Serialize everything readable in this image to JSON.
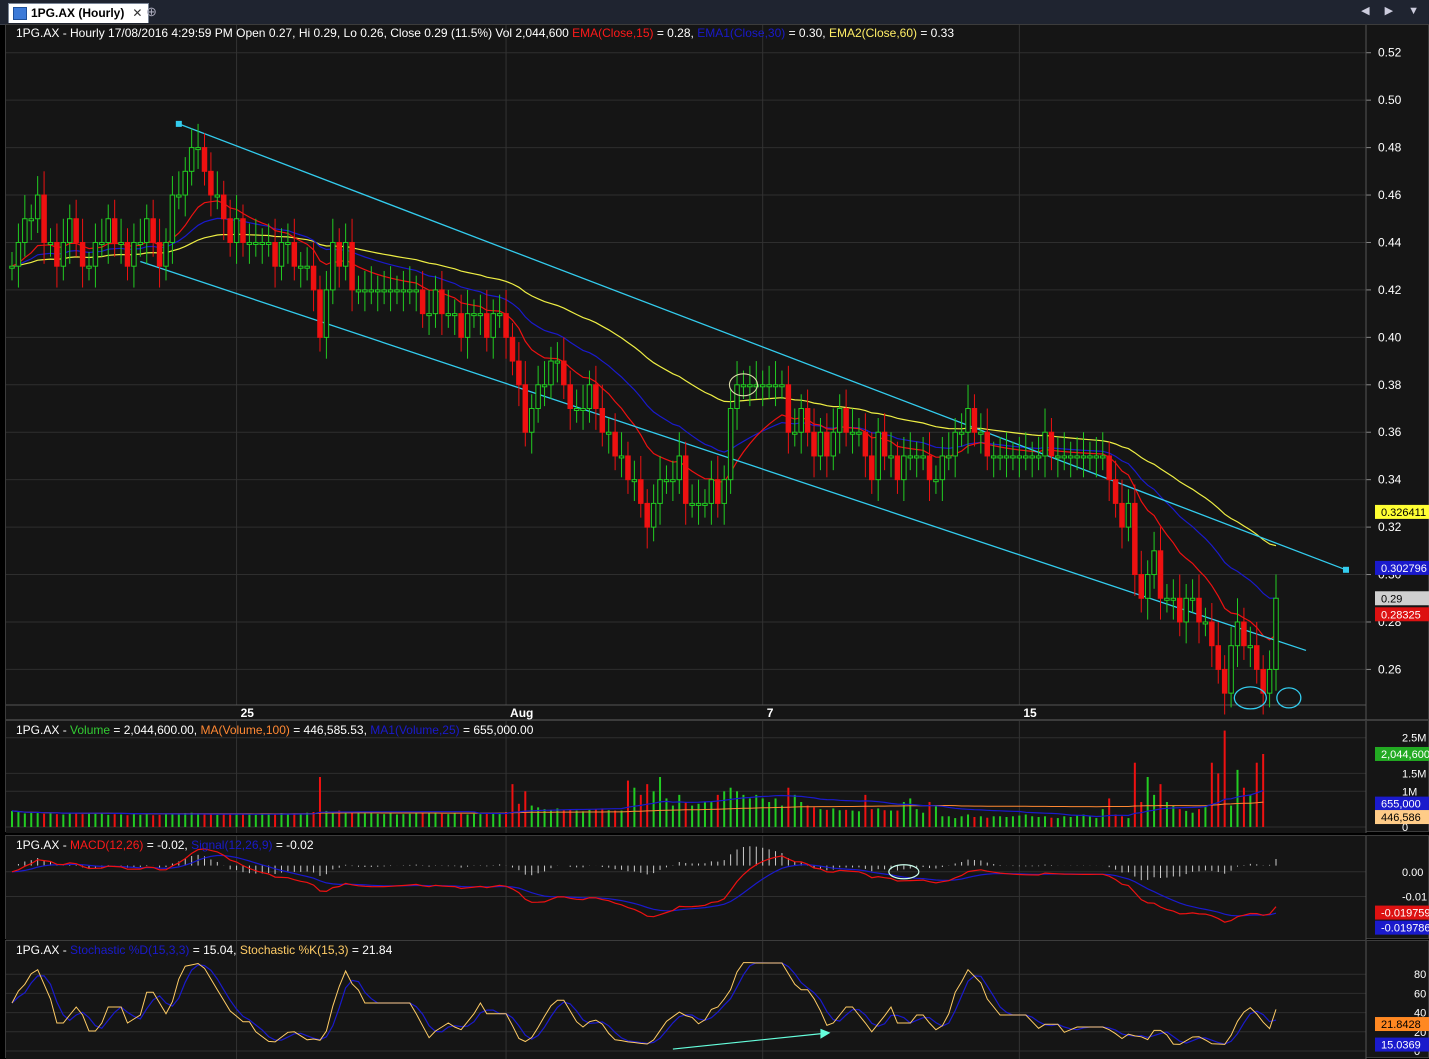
{
  "tab": {
    "title": "1PG.AX (Hourly)",
    "close_glyph": "✕",
    "add_glyph": "⊕",
    "nav": "◀ ▶ ▼"
  },
  "price_header": {
    "prefix": "1PG.AX - Hourly 17/08/2016 4:29:59 PM Open 0.27, Hi 0.29, Lo 0.26, Close 0.29 (11.5%) Vol 2,044,600",
    "ema": "EMA(Close,15)",
    "ema_val": " = 0.28,",
    "ema1": "EMA1(Close,30)",
    "ema1_val": " = 0.30,",
    "ema2": "EMA2(Close,60)",
    "ema2_val": " = 0.33"
  },
  "volume_header": {
    "prefix": "1PG.AX - ",
    "vol": "Volume",
    "vol_val": " = 2,044,600.00,",
    "ma": "MA(Volume,100)",
    "ma_val": " = 446,585.53,",
    "ma1": "MA1(Volume,25)",
    "ma1_val": " = 655,000.00"
  },
  "macd_header": {
    "prefix": "1PG.AX - ",
    "macd": "MACD(12,26)",
    "macd_val": " = -0.02,",
    "sig": "Signal(12,26,9)",
    "sig_val": " = -0.02"
  },
  "stoch_header": {
    "prefix": "1PG.AX - ",
    "d": "Stochastic %D(15,3,3)",
    "d_val": " = 15.04,",
    "k": "Stochastic %K(15,3)",
    "k_val": " = 21.84"
  },
  "colors": {
    "up": "#22cc22",
    "down": "#ee1111",
    "ema15": "#ee1111",
    "ema30": "#1a1acc",
    "ema60": "#eeee44",
    "channel": "#33ccee"
  },
  "chart_data": [
    {
      "type": "candlestick",
      "title": "1PG.AX (Hourly)",
      "x_tick_labels": [
        "25",
        "Aug",
        "7",
        "15"
      ],
      "y_tick_labels": [
        "0.52",
        "0.50",
        "0.48",
        "0.46",
        "0.44",
        "0.42",
        "0.40",
        "0.38",
        "0.36",
        "0.34",
        "0.32",
        "0.30",
        "0.28",
        "0.26"
      ],
      "ylim": [
        0.245,
        0.53
      ],
      "grid": true,
      "closes": [
        0.43,
        0.44,
        0.45,
        0.45,
        0.46,
        0.44,
        0.44,
        0.43,
        0.44,
        0.45,
        0.44,
        0.43,
        0.43,
        0.44,
        0.44,
        0.45,
        0.44,
        0.44,
        0.43,
        0.44,
        0.44,
        0.45,
        0.44,
        0.43,
        0.44,
        0.46,
        0.46,
        0.47,
        0.48,
        0.48,
        0.47,
        0.46,
        0.46,
        0.45,
        0.44,
        0.45,
        0.44,
        0.44,
        0.44,
        0.44,
        0.44,
        0.43,
        0.44,
        0.44,
        0.43,
        0.43,
        0.43,
        0.42,
        0.4,
        0.42,
        0.44,
        0.43,
        0.44,
        0.42,
        0.42,
        0.42,
        0.42,
        0.42,
        0.42,
        0.42,
        0.42,
        0.42,
        0.42,
        0.42,
        0.41,
        0.41,
        0.42,
        0.41,
        0.41,
        0.41,
        0.4,
        0.41,
        0.41,
        0.41,
        0.4,
        0.41,
        0.41,
        0.4,
        0.39,
        0.38,
        0.36,
        0.37,
        0.38,
        0.38,
        0.39,
        0.39,
        0.38,
        0.37,
        0.37,
        0.37,
        0.38,
        0.37,
        0.36,
        0.36,
        0.35,
        0.35,
        0.34,
        0.34,
        0.33,
        0.32,
        0.33,
        0.34,
        0.34,
        0.34,
        0.35,
        0.33,
        0.33,
        0.33,
        0.33,
        0.34,
        0.33,
        0.34,
        0.37,
        0.38,
        0.38,
        0.38,
        0.38,
        0.38,
        0.38,
        0.38,
        0.38,
        0.36,
        0.36,
        0.37,
        0.36,
        0.35,
        0.36,
        0.35,
        0.36,
        0.37,
        0.36,
        0.36,
        0.36,
        0.35,
        0.34,
        0.36,
        0.35,
        0.35,
        0.34,
        0.35,
        0.35,
        0.35,
        0.35,
        0.34,
        0.34,
        0.35,
        0.35,
        0.36,
        0.36,
        0.37,
        0.36,
        0.36,
        0.35,
        0.35,
        0.35,
        0.35,
        0.35,
        0.35,
        0.35,
        0.35,
        0.35,
        0.36,
        0.35,
        0.35,
        0.35,
        0.35,
        0.35,
        0.35,
        0.35,
        0.35,
        0.35,
        0.34,
        0.33,
        0.32,
        0.33,
        0.3,
        0.29,
        0.3,
        0.31,
        0.29,
        0.29,
        0.29,
        0.28,
        0.29,
        0.29,
        0.28,
        0.28,
        0.27,
        0.26,
        0.25,
        0.27,
        0.28,
        0.27,
        0.27,
        0.26,
        0.25,
        0.26,
        0.29
      ],
      "current_price": 0.29,
      "ema15_last": 0.28325,
      "ema30_last": 0.302796,
      "ema60_last": 0.326411,
      "price_labels": {
        "last": "0.29",
        "ema15": "0.28325",
        "ema30": "0.302796",
        "ema60": "0.326411"
      }
    },
    {
      "type": "bar",
      "title": "Volume",
      "y_tick_labels": [
        "2.5M",
        "1.5M",
        "1M",
        "0"
      ],
      "ylim": [
        0,
        2800000
      ],
      "grid": true,
      "values": [
        450000,
        420000,
        380000,
        400000,
        390000,
        370000,
        380000,
        360000,
        350000,
        400000,
        380000,
        360000,
        390000,
        370000,
        380000,
        340000,
        360000,
        350000,
        330000,
        360000,
        340000,
        350000,
        330000,
        340000,
        350000,
        360000,
        380000,
        390000,
        400000,
        380000,
        360000,
        350000,
        340000,
        360000,
        380000,
        370000,
        360000,
        350000,
        340000,
        380000,
        370000,
        360000,
        390000,
        350000,
        380000,
        360000,
        400000,
        420000,
        1400000,
        450000,
        380000,
        460000,
        420000,
        410000,
        400000,
        380000,
        390000,
        370000,
        360000,
        380000,
        350000,
        360000,
        370000,
        380000,
        390000,
        400000,
        380000,
        370000,
        360000,
        380000,
        370000,
        350000,
        370000,
        360000,
        380000,
        390000,
        400000,
        420000,
        1200000,
        650000,
        1000000,
        600000,
        550000,
        500000,
        480000,
        520000,
        470000,
        480000,
        460000,
        440000,
        480000,
        500000,
        520000,
        470000,
        460000,
        460000,
        1300000,
        1100000,
        900000,
        1200000,
        1000000,
        1400000,
        800000,
        600000,
        900000,
        700000,
        600000,
        650000,
        700000,
        700000,
        900000,
        1000000,
        1100000,
        1000000,
        900000,
        800000,
        900000,
        800000,
        700000,
        800000,
        600000,
        1100000,
        900000,
        700000,
        600000,
        550000,
        500000,
        480000,
        520000,
        470000,
        480000,
        460000,
        440000,
        900000,
        500000,
        520000,
        470000,
        460000,
        460000,
        700000,
        800000,
        500000,
        400000,
        700000,
        600000,
        300000,
        300000,
        250000,
        300000,
        350000,
        280000,
        300000,
        260000,
        300000,
        300000,
        280000,
        300000,
        320000,
        350000,
        300000,
        280000,
        300000,
        260000,
        250000,
        300000,
        280000,
        320000,
        350000,
        300000,
        250000,
        500000,
        800000,
        350000,
        300000,
        250000,
        1800000,
        700000,
        1400000,
        900000,
        1200000,
        700000,
        600000,
        500000,
        450000,
        400000,
        500000,
        600000,
        1800000,
        1500000,
        2700000,
        600000,
        1600000,
        1100000,
        900000,
        1800000,
        2044600
      ],
      "ma100_last": 446585.53,
      "ma25_last": 655000,
      "value_labels": {
        "vol": "2,044,600",
        "ma25": "655,000",
        "ma100": "446,586"
      }
    },
    {
      "type": "line",
      "title": "MACD",
      "y_tick_labels": [
        "0.00",
        "-0.01"
      ],
      "ylim": [
        -0.026,
        0.008
      ],
      "grid": true,
      "macd_last": -0.019759,
      "signal_last": -0.019786,
      "value_labels": {
        "macd": "-0.019759",
        "signal": "-0.019786"
      }
    },
    {
      "type": "line",
      "title": "Stochastic",
      "y_tick_labels": [
        "80",
        "60",
        "40",
        "20",
        "0"
      ],
      "ylim": [
        0,
        100
      ],
      "grid": true,
      "d_last": 15.0369,
      "k_last": 21.8428,
      "value_labels": {
        "k": "21.8428",
        "d": "15.0369"
      }
    }
  ]
}
